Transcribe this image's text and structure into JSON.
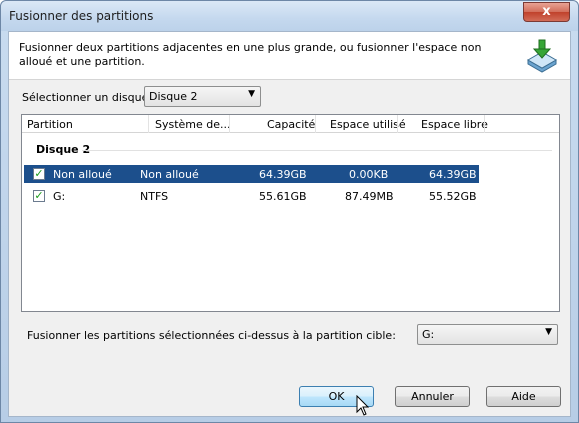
{
  "window": {
    "title": "Fusionner des partitions",
    "close_glyph": "x"
  },
  "banner": {
    "text": "Fusionner deux partitions adjacentes en une plus grande, ou fusionner l'espace non alloué et une partition.",
    "icon": "merge-partition-icon"
  },
  "disk_selector": {
    "label": "Sélectionner un disque:",
    "value": "Disque 2"
  },
  "table": {
    "columns": [
      "Partition",
      "Système de...",
      "Capacité",
      "Espace utilisé",
      "Espace libre"
    ],
    "group": "Disque 2",
    "rows": [
      {
        "partition": "Non alloué",
        "fs": "Non alloué",
        "capacity": "64.39GB",
        "used": "0.00KB",
        "free": "64.39GB",
        "checked": true,
        "selected": true
      },
      {
        "partition": "G:",
        "fs": "NTFS",
        "capacity": "55.61GB",
        "used": "87.49MB",
        "free": "55.52GB",
        "checked": true,
        "selected": false
      }
    ]
  },
  "target": {
    "label": "Fusionner les partitions sélectionnées ci-dessus à la partition cible:",
    "value": "G:"
  },
  "buttons": {
    "ok": "OK",
    "cancel": "Annuler",
    "help": "Aide"
  },
  "colors": {
    "selection": "#1c4f8c",
    "check": "#1a9a1a"
  }
}
